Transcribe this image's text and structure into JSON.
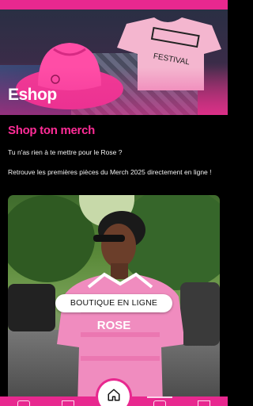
{
  "hero": {
    "title": "Eshop",
    "tshirt_print": "FESTIVAL"
  },
  "shop": {
    "title": "Shop ton merch",
    "line_1": "Tu n'as rien à te mettre pour le Rose ?",
    "line_2": "Retrouve les premières pièces du Merch 2025 directement en ligne !",
    "cta_label": "BOUTIQUE EN LIGNE",
    "jersey_print": "ROSE"
  },
  "nav": {
    "active": "home"
  },
  "colors": {
    "accent": "#e8288f",
    "title_pink": "#ff2c97",
    "background": "#000000"
  },
  "icons": [
    "home-icon",
    "profile-icon",
    "mail-icon",
    "ticket-icon",
    "menu-icon"
  ]
}
